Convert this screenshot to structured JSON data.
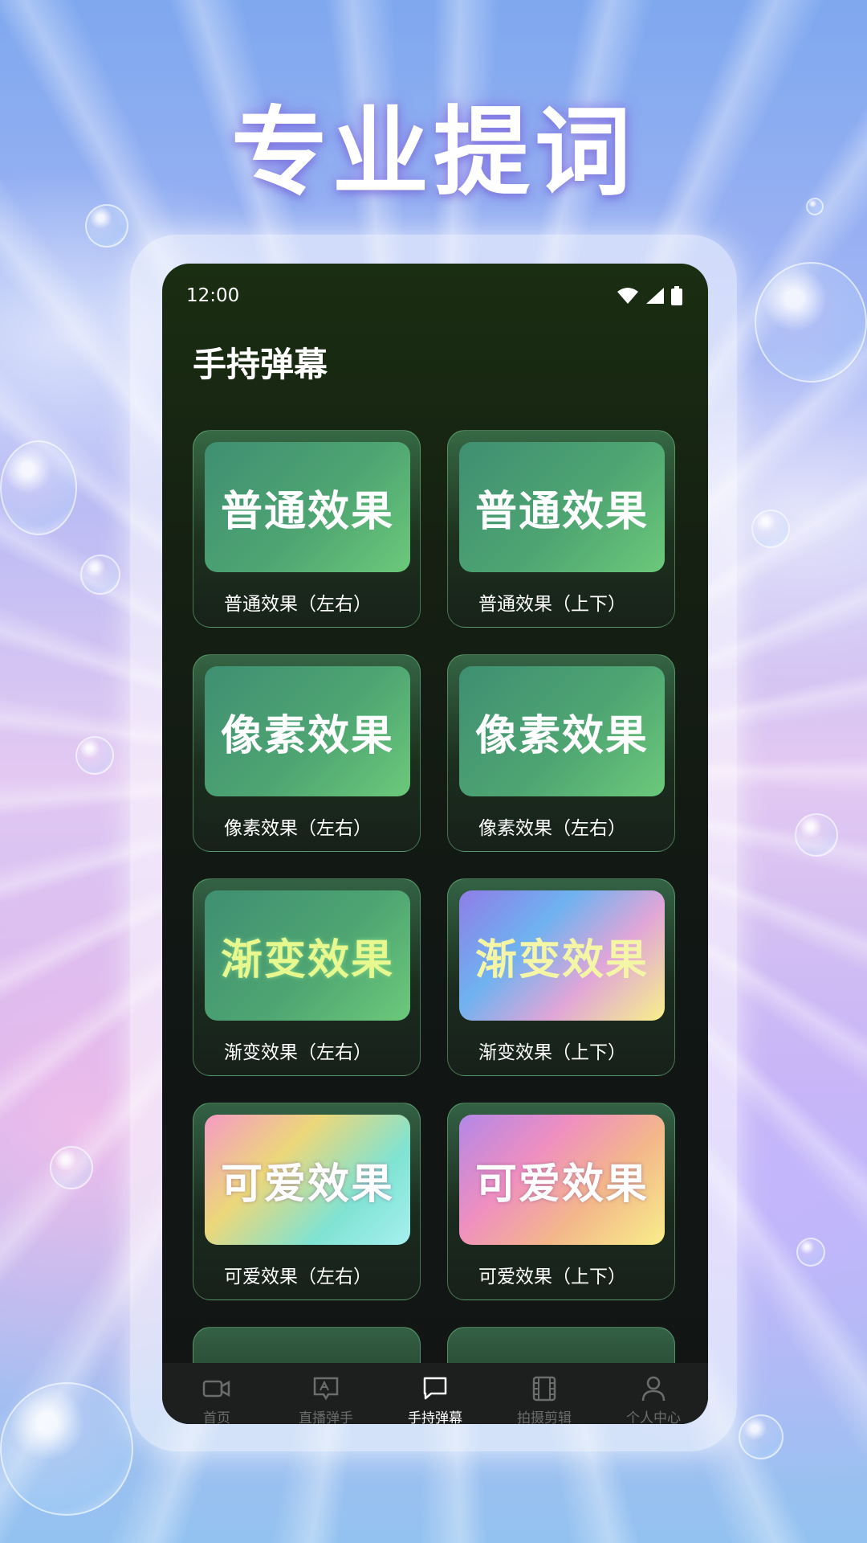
{
  "headline": "专业提词",
  "status_bar": {
    "time": "12:00"
  },
  "screen_title": "手持弹幕",
  "cards": [
    {
      "preview_text": "普通效果",
      "label": "普通效果（左右）"
    },
    {
      "preview_text": "普通效果",
      "label": "普通效果（上下）"
    },
    {
      "preview_text": "像素效果",
      "label": "像素效果（左右）"
    },
    {
      "preview_text": "像素效果",
      "label": "像素效果（左右）"
    },
    {
      "preview_text": "渐变效果",
      "label": "渐变效果（左右）"
    },
    {
      "preview_text": "渐变效果",
      "label": "渐变效果（上下）"
    },
    {
      "preview_text": "可爱效果",
      "label": "可爱效果（左右）"
    },
    {
      "preview_text": "可爱效果",
      "label": "可爱效果（上下）"
    }
  ],
  "bottom_nav": [
    {
      "label": "首页",
      "icon": "video-camera-icon",
      "active": false
    },
    {
      "label": "直播弹手",
      "icon": "message-text-icon",
      "active": false
    },
    {
      "label": "手持弹幕",
      "icon": "chat-bubble-icon",
      "active": true
    },
    {
      "label": "拍摄剪辑",
      "icon": "film-icon",
      "active": false
    },
    {
      "label": "个人中心",
      "icon": "person-icon",
      "active": false
    }
  ]
}
